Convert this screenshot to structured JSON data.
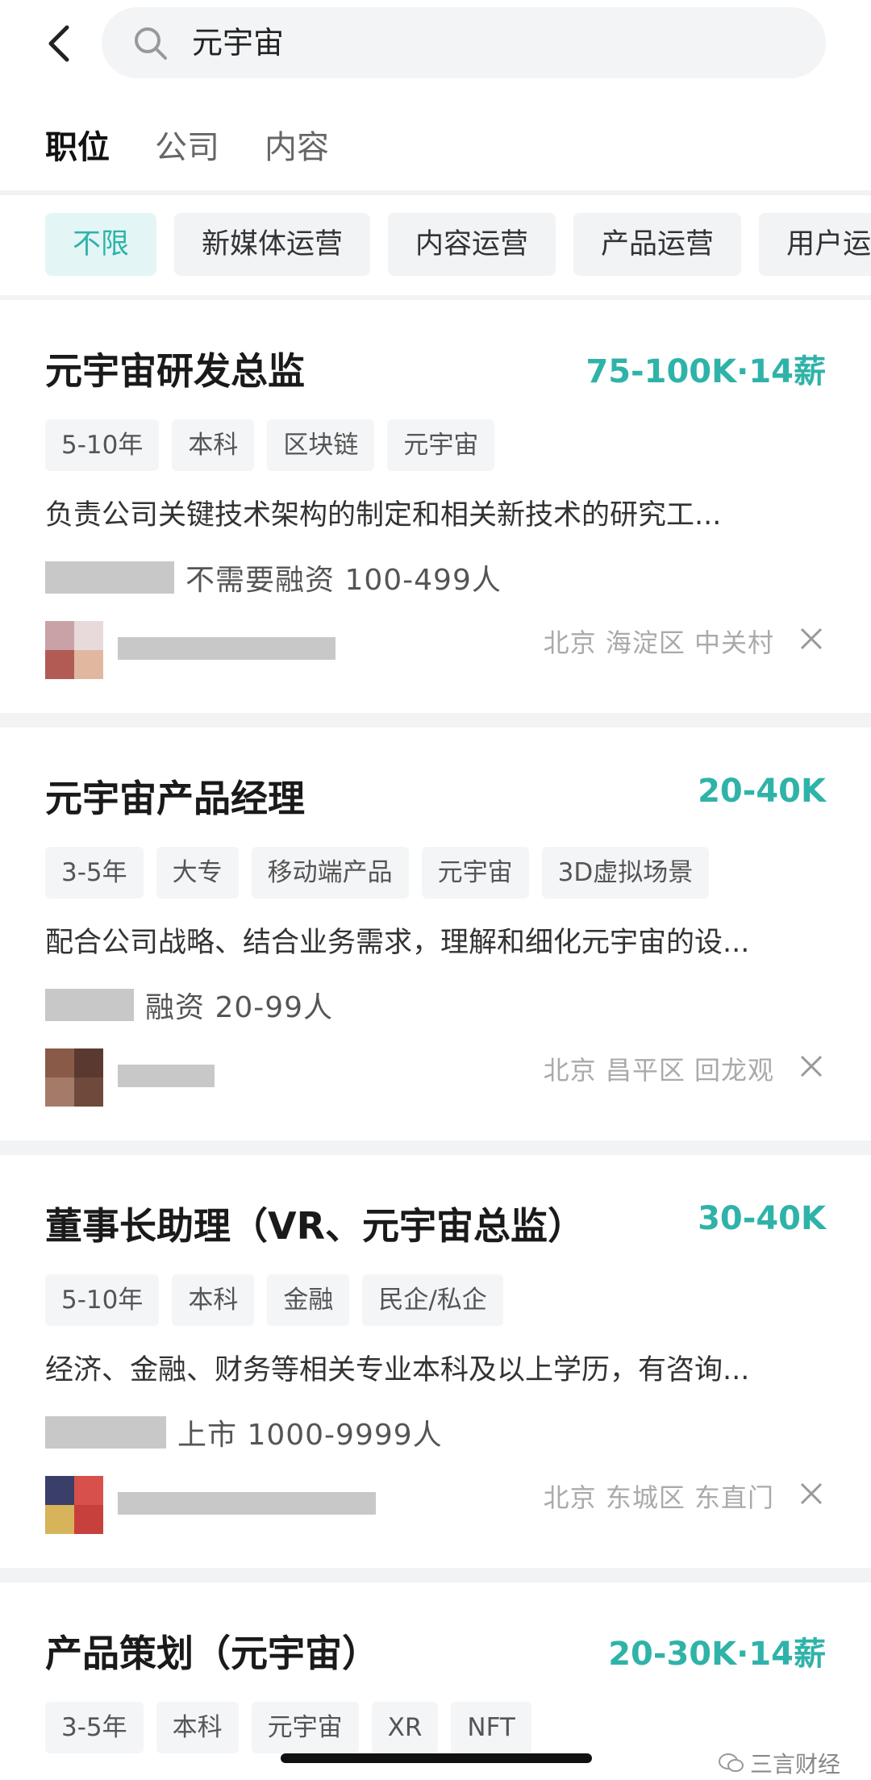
{
  "search": {
    "query": "元宇宙"
  },
  "tabs": [
    "职位",
    "公司",
    "内容"
  ],
  "filters": [
    "不限",
    "新媒体运营",
    "内容运营",
    "产品运营",
    "用户运营"
  ],
  "jobs": [
    {
      "title": "元宇宙研发总监",
      "salary": "75-100K·14薪",
      "tags": [
        "5-10年",
        "本科",
        "区块链",
        "元宇宙"
      ],
      "desc": "负责公司关键技术架构的制定和相关新技术的研究工...",
      "company_info": "不需要融资   100-499人",
      "location": "北京 海淀区 中关村"
    },
    {
      "title": "元宇宙产品经理",
      "salary": "20-40K",
      "tags": [
        "3-5年",
        "大专",
        "移动端产品",
        "元宇宙",
        "3D虚拟场景"
      ],
      "desc": "配合公司战略、结合业务需求，理解和细化元宇宙的设...",
      "company_info": "融资   20-99人",
      "location": "北京 昌平区 回龙观"
    },
    {
      "title": "董事长助理（VR、元宇宙总监）",
      "salary": "30-40K",
      "tags": [
        "5-10年",
        "本科",
        "金融",
        "民企/私企"
      ],
      "desc": "经济、金融、财务等相关专业本科及以上学历，有咨询...",
      "company_info": "上市   1000-9999人",
      "location": "北京 东城区 东直门"
    },
    {
      "title": "产品策划（元宇宙）",
      "salary": "20-30K·14薪",
      "tags": [
        "3-5年",
        "本科",
        "元宇宙",
        "XR",
        "NFT"
      ]
    }
  ],
  "watermark": "三言财经",
  "colors": {
    "accent": "#2fb3a9",
    "chip_active_bg": "#e3f6f5",
    "page_bg": "#f2f3f5"
  }
}
